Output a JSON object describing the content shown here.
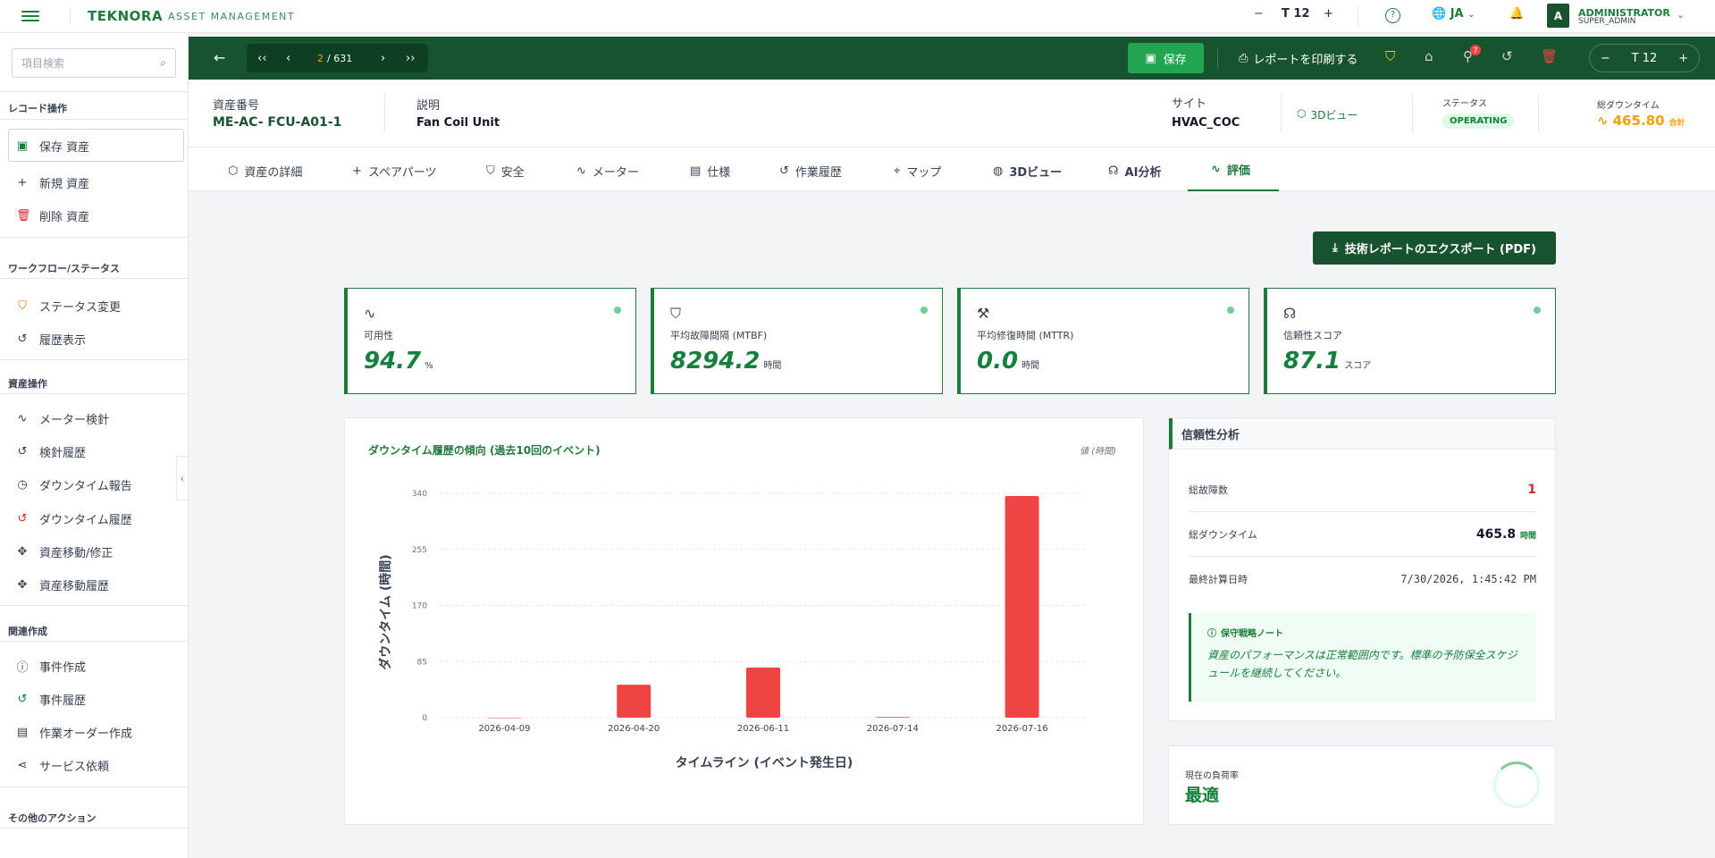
{
  "app": {
    "logo": "TEKNORA",
    "subtitle": "ASSET MANAGEMENT"
  },
  "topbar": {
    "font_size": "12",
    "lang": "JA",
    "user_initial": "A",
    "user_name": "ADMINISTRATOR",
    "user_role": "SUPER_ADMIN"
  },
  "sidebar": {
    "search_placeholder": "項目検索",
    "sections": [
      {
        "title": "レコード操作",
        "items": [
          {
            "label": "保存 資産",
            "icon": "save-icon"
          },
          {
            "label": "新規 資産",
            "icon": "plus-icon"
          },
          {
            "label": "削除 資産",
            "icon": "trash-icon"
          }
        ]
      },
      {
        "title": "ワークフロー/ステータス",
        "items": [
          {
            "label": "ステータス変更",
            "icon": "shield-icon"
          },
          {
            "label": "履歴表示",
            "icon": "history-icon"
          }
        ]
      },
      {
        "title": "資産操作",
        "items": [
          {
            "label": "メーター検針",
            "icon": "pulse-icon"
          },
          {
            "label": "検針履歴",
            "icon": "history-icon"
          },
          {
            "label": "ダウンタイム報告",
            "icon": "clock-icon"
          },
          {
            "label": "ダウンタイム履歴",
            "icon": "history-icon"
          },
          {
            "label": "資産移動/修正",
            "icon": "move-icon"
          },
          {
            "label": "資産移動履歴",
            "icon": "move-icon"
          }
        ]
      },
      {
        "title": "関連作成",
        "items": [
          {
            "label": "事件作成",
            "icon": "alert-icon"
          },
          {
            "label": "事件履歴",
            "icon": "history-icon"
          },
          {
            "label": "作業オーダー作成",
            "icon": "document-icon"
          },
          {
            "label": "サービス依頼",
            "icon": "share-icon"
          }
        ]
      },
      {
        "title": "その他のアクション",
        "items": []
      }
    ]
  },
  "toolbar": {
    "page_current": "2",
    "page_total": "/ 631",
    "save_label": "保存",
    "print_label": "レポートを印刷する",
    "attachments_count": "7",
    "font_size": "12"
  },
  "header": {
    "asset_no_label": "資産番号",
    "asset_no": "ME-AC- FCU-A01-1",
    "desc_label": "説明",
    "desc": "Fan Coil Unit",
    "site_label": "サイト",
    "site": "HVAC_COC",
    "view3d_label": "3Dビュー",
    "status_label": "ステータス",
    "status": "OPERATING",
    "downtime_label": "総ダウンタイム",
    "downtime": "465.80",
    "downtime_unit": "合計"
  },
  "tabs": [
    "資産の詳細",
    "スペアパーツ",
    "安全",
    "メーター",
    "仕様",
    "作業履歴",
    "マップ",
    "3Dビュー",
    "AI分析",
    "評価"
  ],
  "export_label": "技術レポートのエクスポート (PDF)",
  "kpis": [
    {
      "label": "可用性",
      "value": "94.7",
      "unit": "%",
      "icon": "pulse-icon"
    },
    {
      "label": "平均故障間隔 (MTBF)",
      "value": "8294.2",
      "unit": "時間",
      "icon": "shield-icon"
    },
    {
      "label": "平均修復時間 (MTTR)",
      "value": "0.0",
      "unit": "時間",
      "icon": "wrench-icon"
    },
    {
      "label": "信頼性スコア",
      "value": "87.1",
      "unit": "スコア",
      "icon": "brain-icon"
    }
  ],
  "chart_data": {
    "type": "bar",
    "title": "ダウンタイム履歴の傾向 (過去10回のイベント)",
    "legend": "値 (時間)",
    "xlabel": "タイムライン (イベント発生日)",
    "ylabel": "ダウンタイム (時間)",
    "categories": [
      "2026-04-09",
      "2026-04-20",
      "2026-06-11",
      "2026-07-14",
      "2026-07-16"
    ],
    "values": [
      0,
      50,
      76,
      1,
      336
    ],
    "yticks": [
      0,
      85,
      170,
      255,
      340
    ],
    "ylim": [
      0,
      340
    ],
    "color": "#ef4444",
    "grid": true
  },
  "reliability": {
    "title": "信頼性分析",
    "rows": [
      {
        "label": "総故障数",
        "value": "1",
        "unit": ""
      },
      {
        "label": "総ダウンタイム",
        "value": "465.8",
        "unit": "時間"
      },
      {
        "label": "最終計算日時",
        "value": "7/30/2026, 1:45:42 PM",
        "unit": ""
      }
    ],
    "note_title": "保守戦略ノート",
    "note_text": "資産のパフォーマンスは正常範囲内です。標準の予防保全スケジュールを継続してください。"
  },
  "load": {
    "label": "現在の負荷率",
    "value": "最適"
  }
}
